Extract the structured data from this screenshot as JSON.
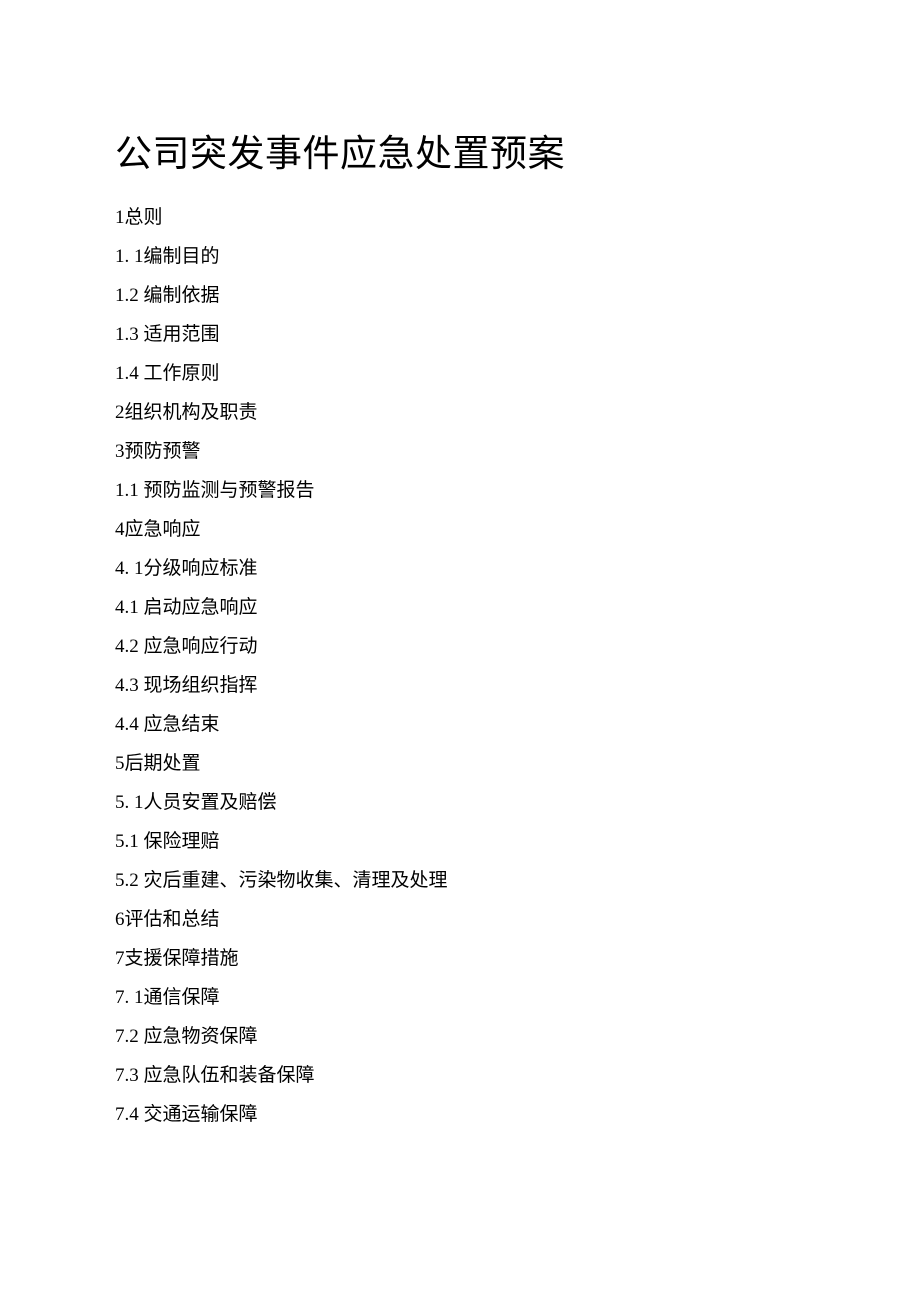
{
  "title": "公司突发事件应急处置预案",
  "toc": [
    {
      "text": "1总则"
    },
    {
      "text": "1. 1编制目的"
    },
    {
      "text": "1.2  编制依据"
    },
    {
      "text": "1.3  适用范围"
    },
    {
      "text": "1.4  工作原则"
    },
    {
      "text": "2组织机构及职责"
    },
    {
      "text": "3预防预警"
    },
    {
      "text": "1.1  预防监测与预警报告"
    },
    {
      "text": "4应急响应"
    },
    {
      "text": "4. 1分级响应标准"
    },
    {
      "text": "4.1  启动应急响应"
    },
    {
      "text": "4.2  应急响应行动"
    },
    {
      "text": "4.3  现场组织指挥"
    },
    {
      "text": "4.4  应急结束"
    },
    {
      "text": "5后期处置"
    },
    {
      "text": "5. 1人员安置及赔偿"
    },
    {
      "text": "5.1  保险理赔"
    },
    {
      "text": "5.2  灾后重建、污染物收集、清理及处理"
    },
    {
      "text": "6评估和总结"
    },
    {
      "text": "7支援保障措施"
    },
    {
      "text": "7. 1通信保障"
    },
    {
      "text": "7.2  应急物资保障"
    },
    {
      "text": "7.3  应急队伍和装备保障"
    },
    {
      "text": "7.4  交通运输保障"
    }
  ]
}
